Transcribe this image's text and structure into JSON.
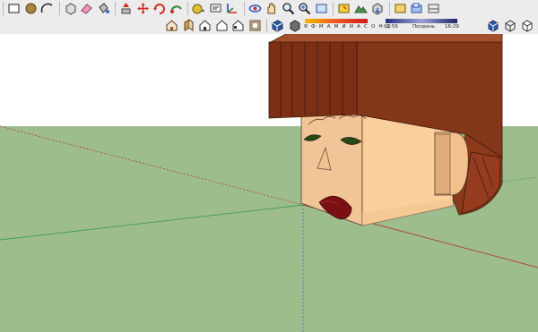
{
  "toolbar": {
    "row1_icons": [
      "rectangle-icon",
      "circle-icon",
      "arc-icon",
      "make-component-icon",
      "eraser-icon",
      "paint-bucket-icon",
      "push-pull-icon",
      "move-icon",
      "rotate-icon",
      "follow-me-icon",
      "scale-icon",
      "offset-icon",
      "tape-measure-icon",
      "dimension-icon",
      "protractor-icon",
      "text-icon",
      "axes-icon",
      "section-plane-icon",
      "orbit-icon",
      "pan-icon",
      "zoom-icon",
      "zoom-extents-icon",
      "previous-view-icon",
      "add-location-icon",
      "toggle-terrain-icon",
      "get-models-icon",
      "share-model-icon",
      "x-ray-icon",
      "wireframe-icon",
      "hidden-line-icon",
      "shaded-icon",
      "shaded-textures-icon",
      "monochrome-icon"
    ],
    "row2_icons": [
      "standard-view-icon",
      "front-view-icon",
      "right-view-icon",
      "back-view-icon",
      "left-view-icon",
      "top-view-icon",
      "parallel-projection-icon",
      "shadow-toggle-icon"
    ]
  },
  "shadow_settings": {
    "months": "Я Ф М А М И И А С О Н Д",
    "time_start": "07:56",
    "time_label": "Полдень",
    "time_end": "16:29"
  },
  "colors": {
    "sky": "#ffffff",
    "ground": "#9dbd8c",
    "hat": "#7f3117",
    "face": "#f8c795",
    "face_shadow": "#e7b182"
  }
}
